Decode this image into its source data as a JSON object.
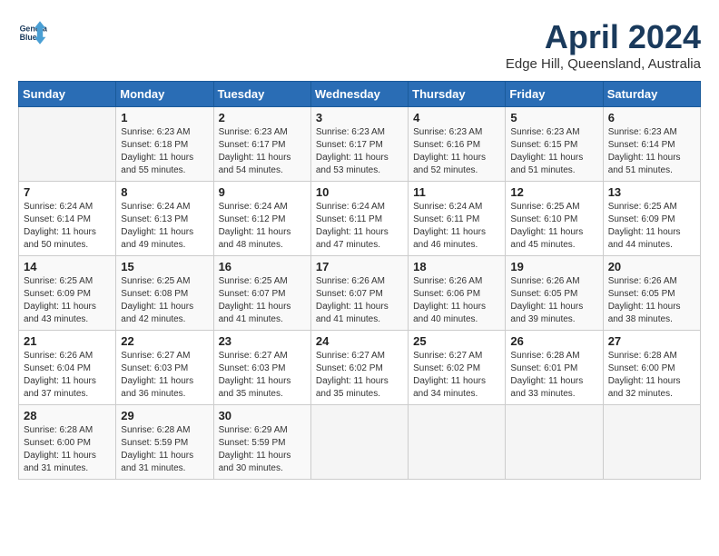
{
  "header": {
    "logo_line1": "General",
    "logo_line2": "Blue",
    "month": "April 2024",
    "location": "Edge Hill, Queensland, Australia"
  },
  "weekdays": [
    "Sunday",
    "Monday",
    "Tuesday",
    "Wednesday",
    "Thursday",
    "Friday",
    "Saturday"
  ],
  "weeks": [
    [
      {
        "day": "",
        "info": ""
      },
      {
        "day": "1",
        "info": "Sunrise: 6:23 AM\nSunset: 6:18 PM\nDaylight: 11 hours\nand 55 minutes."
      },
      {
        "day": "2",
        "info": "Sunrise: 6:23 AM\nSunset: 6:17 PM\nDaylight: 11 hours\nand 54 minutes."
      },
      {
        "day": "3",
        "info": "Sunrise: 6:23 AM\nSunset: 6:17 PM\nDaylight: 11 hours\nand 53 minutes."
      },
      {
        "day": "4",
        "info": "Sunrise: 6:23 AM\nSunset: 6:16 PM\nDaylight: 11 hours\nand 52 minutes."
      },
      {
        "day": "5",
        "info": "Sunrise: 6:23 AM\nSunset: 6:15 PM\nDaylight: 11 hours\nand 51 minutes."
      },
      {
        "day": "6",
        "info": "Sunrise: 6:23 AM\nSunset: 6:14 PM\nDaylight: 11 hours\nand 51 minutes."
      }
    ],
    [
      {
        "day": "7",
        "info": "Sunrise: 6:24 AM\nSunset: 6:14 PM\nDaylight: 11 hours\nand 50 minutes."
      },
      {
        "day": "8",
        "info": "Sunrise: 6:24 AM\nSunset: 6:13 PM\nDaylight: 11 hours\nand 49 minutes."
      },
      {
        "day": "9",
        "info": "Sunrise: 6:24 AM\nSunset: 6:12 PM\nDaylight: 11 hours\nand 48 minutes."
      },
      {
        "day": "10",
        "info": "Sunrise: 6:24 AM\nSunset: 6:11 PM\nDaylight: 11 hours\nand 47 minutes."
      },
      {
        "day": "11",
        "info": "Sunrise: 6:24 AM\nSunset: 6:11 PM\nDaylight: 11 hours\nand 46 minutes."
      },
      {
        "day": "12",
        "info": "Sunrise: 6:25 AM\nSunset: 6:10 PM\nDaylight: 11 hours\nand 45 minutes."
      },
      {
        "day": "13",
        "info": "Sunrise: 6:25 AM\nSunset: 6:09 PM\nDaylight: 11 hours\nand 44 minutes."
      }
    ],
    [
      {
        "day": "14",
        "info": "Sunrise: 6:25 AM\nSunset: 6:09 PM\nDaylight: 11 hours\nand 43 minutes."
      },
      {
        "day": "15",
        "info": "Sunrise: 6:25 AM\nSunset: 6:08 PM\nDaylight: 11 hours\nand 42 minutes."
      },
      {
        "day": "16",
        "info": "Sunrise: 6:25 AM\nSunset: 6:07 PM\nDaylight: 11 hours\nand 41 minutes."
      },
      {
        "day": "17",
        "info": "Sunrise: 6:26 AM\nSunset: 6:07 PM\nDaylight: 11 hours\nand 41 minutes."
      },
      {
        "day": "18",
        "info": "Sunrise: 6:26 AM\nSunset: 6:06 PM\nDaylight: 11 hours\nand 40 minutes."
      },
      {
        "day": "19",
        "info": "Sunrise: 6:26 AM\nSunset: 6:05 PM\nDaylight: 11 hours\nand 39 minutes."
      },
      {
        "day": "20",
        "info": "Sunrise: 6:26 AM\nSunset: 6:05 PM\nDaylight: 11 hours\nand 38 minutes."
      }
    ],
    [
      {
        "day": "21",
        "info": "Sunrise: 6:26 AM\nSunset: 6:04 PM\nDaylight: 11 hours\nand 37 minutes."
      },
      {
        "day": "22",
        "info": "Sunrise: 6:27 AM\nSunset: 6:03 PM\nDaylight: 11 hours\nand 36 minutes."
      },
      {
        "day": "23",
        "info": "Sunrise: 6:27 AM\nSunset: 6:03 PM\nDaylight: 11 hours\nand 35 minutes."
      },
      {
        "day": "24",
        "info": "Sunrise: 6:27 AM\nSunset: 6:02 PM\nDaylight: 11 hours\nand 35 minutes."
      },
      {
        "day": "25",
        "info": "Sunrise: 6:27 AM\nSunset: 6:02 PM\nDaylight: 11 hours\nand 34 minutes."
      },
      {
        "day": "26",
        "info": "Sunrise: 6:28 AM\nSunset: 6:01 PM\nDaylight: 11 hours\nand 33 minutes."
      },
      {
        "day": "27",
        "info": "Sunrise: 6:28 AM\nSunset: 6:00 PM\nDaylight: 11 hours\nand 32 minutes."
      }
    ],
    [
      {
        "day": "28",
        "info": "Sunrise: 6:28 AM\nSunset: 6:00 PM\nDaylight: 11 hours\nand 31 minutes."
      },
      {
        "day": "29",
        "info": "Sunrise: 6:28 AM\nSunset: 5:59 PM\nDaylight: 11 hours\nand 31 minutes."
      },
      {
        "day": "30",
        "info": "Sunrise: 6:29 AM\nSunset: 5:59 PM\nDaylight: 11 hours\nand 30 minutes."
      },
      {
        "day": "",
        "info": ""
      },
      {
        "day": "",
        "info": ""
      },
      {
        "day": "",
        "info": ""
      },
      {
        "day": "",
        "info": ""
      }
    ]
  ]
}
